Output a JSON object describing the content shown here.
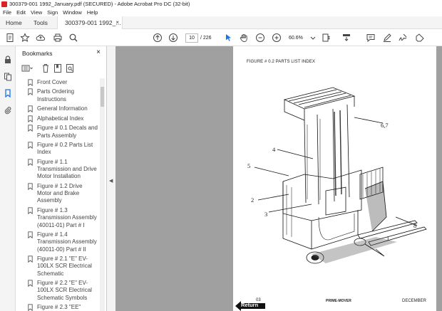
{
  "window": {
    "title": "300379-001 1992_January.pdf (SECURED) - Adobe Acrobat Pro DC (32-bit)"
  },
  "menu": {
    "items": [
      "File",
      "Edit",
      "View",
      "Sign",
      "Window",
      "Help"
    ]
  },
  "tabs": {
    "home": "Home",
    "tools": "Tools",
    "document": "300379-001 1992_...",
    "close": "×"
  },
  "toolbar": {
    "page_current": "10",
    "page_total": "/ 226",
    "zoom": "60.6%"
  },
  "panel": {
    "title": "Bookmarks",
    "close": "×",
    "bookmarks": [
      "Front Cover",
      "Parts Ordering Instructions",
      "General Information",
      "Alphabetical Index",
      "Figure # 0.1 Decals and Parts Assembly",
      "Figure # 0.2 Parts List Index",
      "Figure # 1.1 Transmission and Drive Motor Installation",
      "Figure # 1.2 Drive Motor and Brake Assembly",
      "Figure # 1.3 Transmission Assembly (40011-01) Part # I",
      "Figure # 1.4 Transmission Assembly (40011-00) Part # II",
      "Figure # 2.1 \"E\" EV-100LX SCR Electrical Schematic",
      "Figure # 2.2 \"E\" EV-100LX SCR Electrical Schematic Symbols",
      "Figure # 2.3 \"EE\""
    ]
  },
  "document": {
    "heading": "FIGURE # 0.2  PARTS LIST INDEX",
    "callouts": {
      "c67": "6,7",
      "c4": "4",
      "c5": "5",
      "c2": "2",
      "c3": "3",
      "c8": "8",
      "c1": "1"
    },
    "footer_left": "03",
    "footer_logo": "PRIME-MOVER",
    "footer_right": "DECEMBER",
    "return_label": "Return"
  },
  "colors": {
    "accent": "#1a73e8",
    "chrome": "#f4f4f4",
    "viewer_bg": "#a0a0a0"
  }
}
